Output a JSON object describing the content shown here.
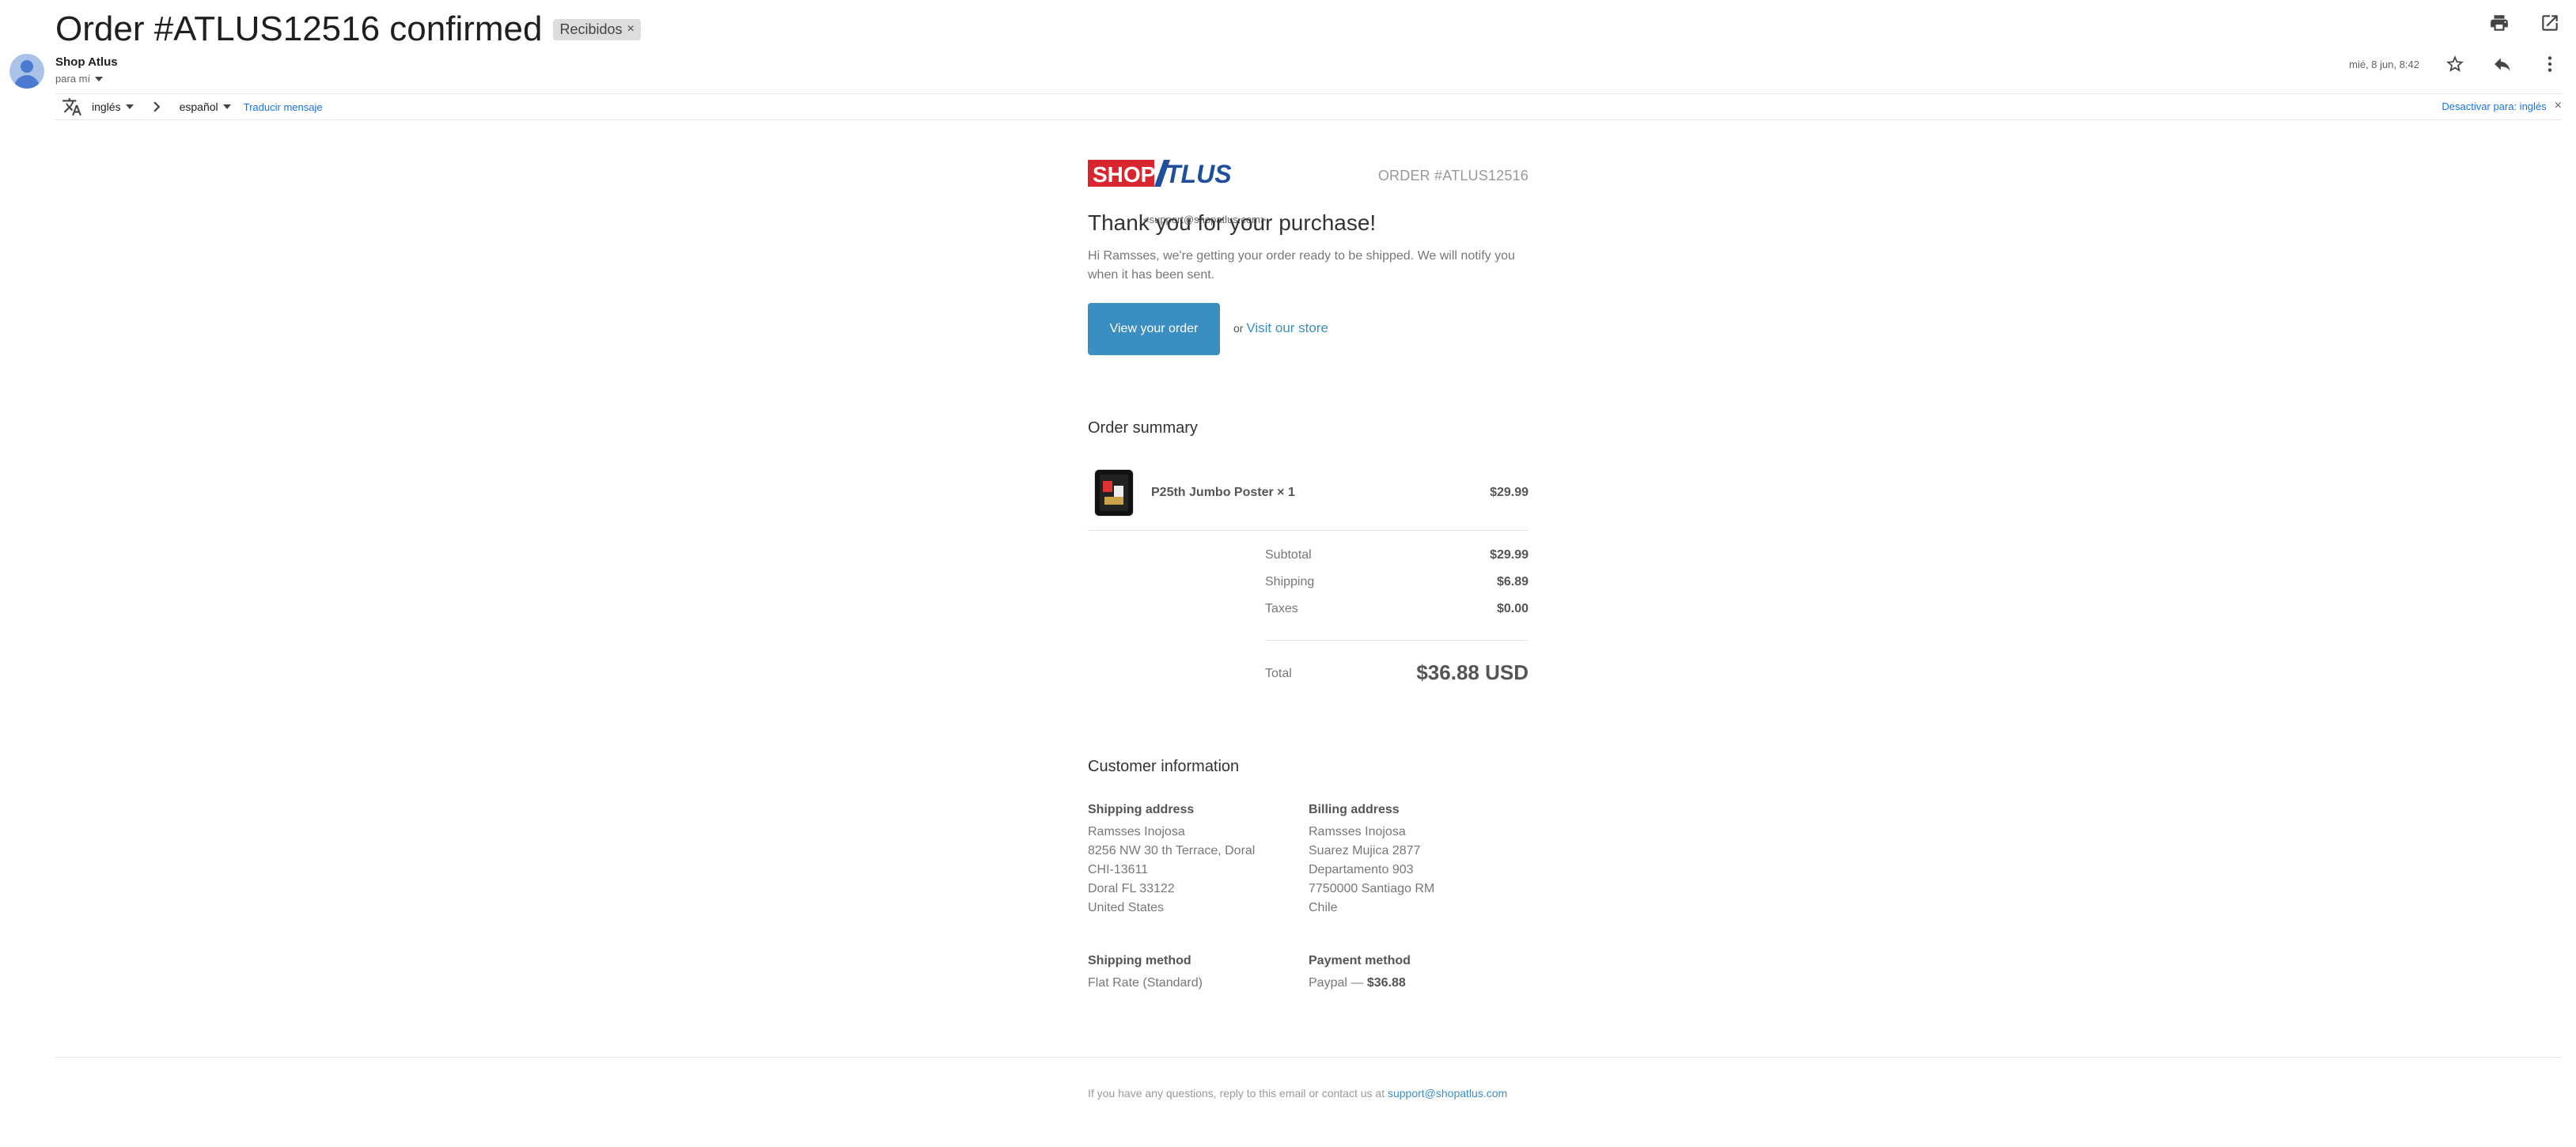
{
  "header": {
    "subject": "Order #ATLUS12516 confirmed",
    "label": "Recibidos",
    "label_remove": "×"
  },
  "sender": {
    "name": "Shop Atlus",
    "email": "<support@shopatlus.com>",
    "to": "para mí",
    "date": "mié, 8 jun, 8:42"
  },
  "translate": {
    "from_lang": "inglés",
    "to_lang": "español",
    "translate_link": "Traducir mensaje",
    "disable": "Desactivar para: inglés",
    "close": "×"
  },
  "email": {
    "logo_text": "SHOP ATLUS",
    "order_number": "ORDER #ATLUS12516",
    "heading": "Thank you for your purchase!",
    "intro": "Hi Ramsses, we're getting your order ready to be shipped. We will notify you when it has been sent.",
    "button": "View your order",
    "or": "or",
    "store_link": "Visit our store",
    "summary_title": "Order summary",
    "item": {
      "name": "P25th Jumbo Poster × 1",
      "price": "$29.99"
    },
    "totals": {
      "subtotal_label": "Subtotal",
      "subtotal": "$29.99",
      "shipping_label": "Shipping",
      "shipping": "$6.89",
      "taxes_label": "Taxes",
      "taxes": "$0.00",
      "total_label": "Total",
      "total": "$36.88 USD"
    },
    "customer_title": "Customer information",
    "shipping_address": {
      "title": "Shipping address",
      "lines": [
        "Ramsses Inojosa",
        "8256 NW 30 th Terrace, Doral",
        "CHI-13611",
        "Doral FL 33122",
        "United States"
      ]
    },
    "billing_address": {
      "title": "Billing address",
      "lines": [
        "Ramsses Inojosa",
        "Suarez Mujica 2877",
        "Departamento 903",
        "7750000 Santiago RM",
        "Chile"
      ]
    },
    "shipping_method": {
      "title": "Shipping method",
      "value": "Flat Rate (Standard)"
    },
    "payment_method": {
      "title": "Payment method",
      "prefix": "Paypal — ",
      "amount": "$36.88"
    },
    "footer_text": "If you have any questions, reply to this email or contact us at ",
    "footer_email": "support@shopatlus.com"
  },
  "colors": {
    "accent": "#3b8ec2",
    "logo_red": "#d7262e",
    "logo_blue": "#1f4e9c",
    "gmail_link": "#1a73e8"
  }
}
